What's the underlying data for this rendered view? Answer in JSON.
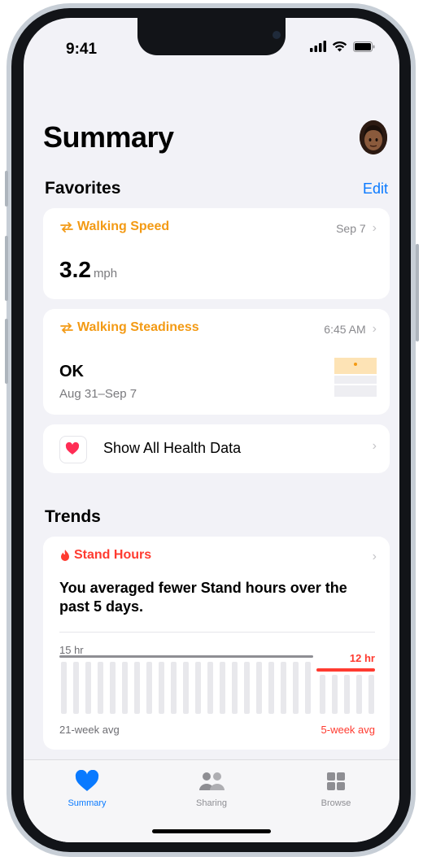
{
  "status": {
    "time": "9:41"
  },
  "header": {
    "title": "Summary"
  },
  "favorites": {
    "heading": "Favorites",
    "edit_label": "Edit",
    "walking_speed": {
      "label": "Walking Speed",
      "date": "Sep 7",
      "value": "3.2",
      "unit": "mph"
    },
    "walking_steadiness": {
      "label": "Walking Steadiness",
      "time": "6:45 AM",
      "value": "OK",
      "range": "Aug 31–Sep 7"
    },
    "show_all_label": "Show All Health Data"
  },
  "trends": {
    "heading": "Trends",
    "stand_hours": {
      "label": "Stand Hours",
      "message": "You averaged fewer Stand hours over the past 5 days.",
      "left_value": "15 hr",
      "right_value": "12 hr",
      "left_caption": "21-week avg",
      "right_caption": "5-week avg"
    }
  },
  "tabs": [
    {
      "label": "Summary",
      "active": true
    },
    {
      "label": "Sharing",
      "active": false
    },
    {
      "label": "Browse",
      "active": false
    }
  ],
  "colors": {
    "accent_blue": "#0a7aff",
    "mobility_orange": "#f39a14",
    "activity_red": "#ff3b30",
    "heart_pink": "#ff2d55"
  }
}
